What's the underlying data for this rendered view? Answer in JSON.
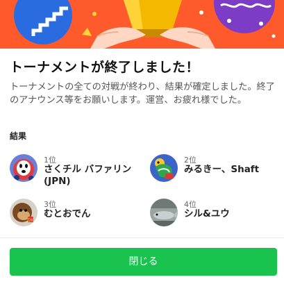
{
  "dialog": {
    "title": "トーナメントが終了しました！",
    "description": "トーナメントの全ての対戦が終わり、結果が確定しました。終了のアナウンス等をお願いします。運営、お疲れ様でした。",
    "results_label": "結果",
    "results": [
      {
        "rank": "1位",
        "name": "さくチル バファリン(JPN)",
        "avatar_icon": "shy-guy-avatar-icon"
      },
      {
        "rank": "2位",
        "name": "みるきー、Shaft",
        "avatar_icon": "koopa-avatar-icon"
      },
      {
        "rank": "3位",
        "name": "むとおでん",
        "avatar_icon": "donkey-kong-avatar-icon"
      },
      {
        "rank": "4位",
        "name": "シル&ユウ",
        "avatar_icon": "fish-avatar-icon"
      }
    ],
    "close_label": "閉じる"
  },
  "colors": {
    "banner": "#ff5a2c",
    "button": "#19c34e",
    "button_text": "#ffffff"
  }
}
